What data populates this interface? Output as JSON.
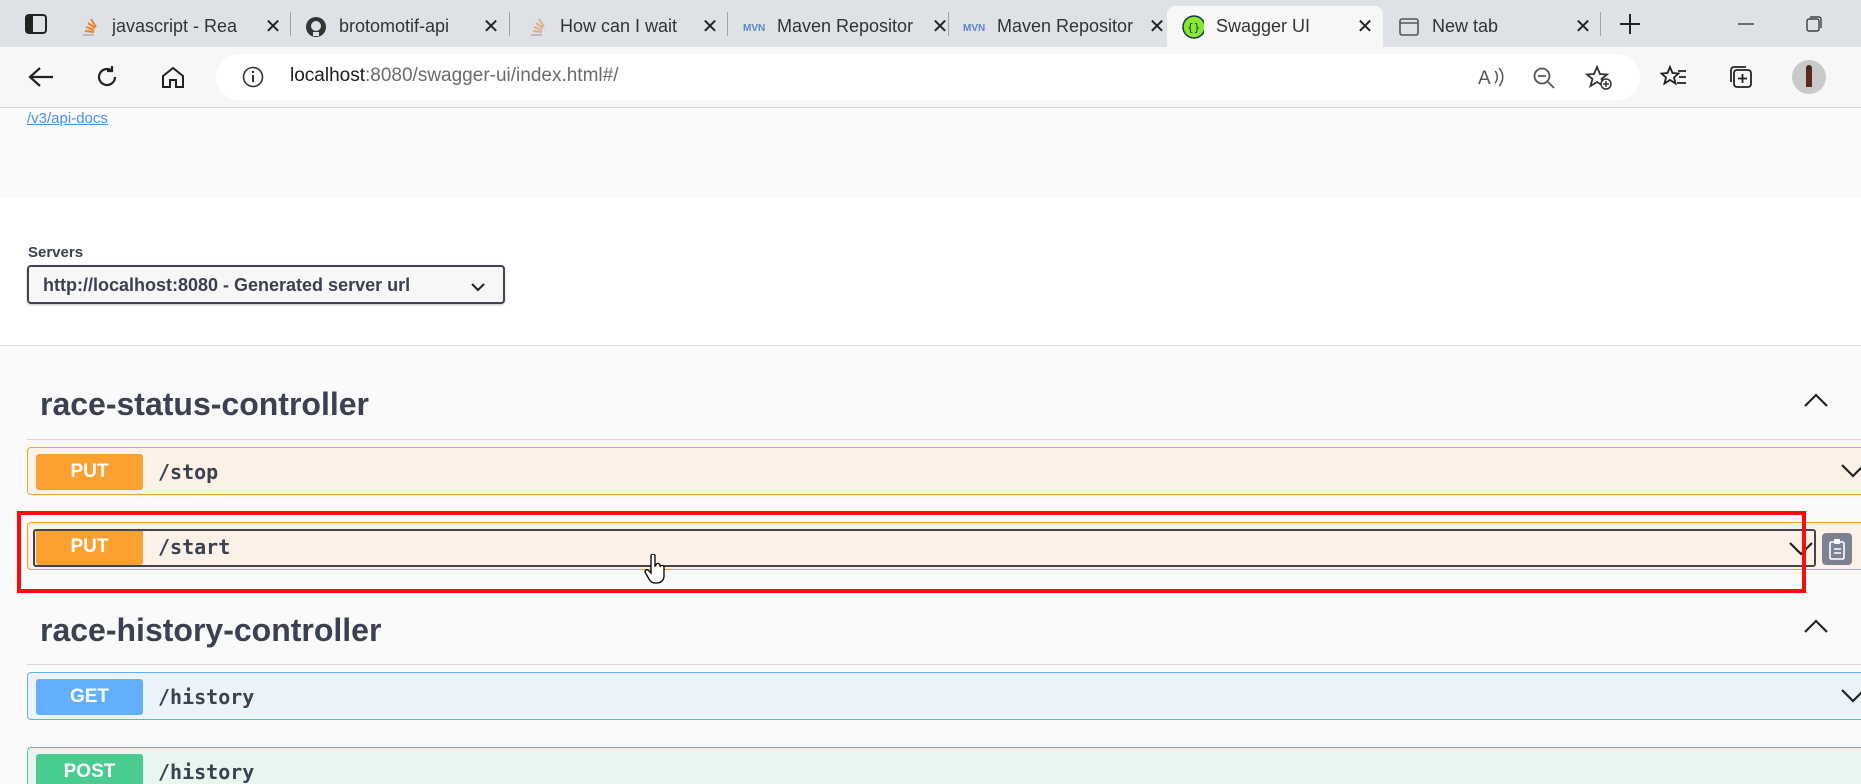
{
  "browser": {
    "tabs": [
      {
        "title": "javascript - Rea",
        "icon": "stackoverflow-icon"
      },
      {
        "title": "brotomotif-api",
        "icon": "github-icon"
      },
      {
        "title": "How can I wait",
        "icon": "stackoverflow-icon"
      },
      {
        "title": "Maven Repositor",
        "icon": "maven-icon"
      },
      {
        "title": "Maven Repositor",
        "icon": "maven-icon"
      },
      {
        "title": "Swagger UI",
        "icon": "swagger-icon"
      },
      {
        "title": "New tab",
        "icon": "newtab-icon"
      }
    ],
    "active_tab_index": 5,
    "maven_icon_text": "MVN",
    "url_host": "localhost",
    "url_rest": ":8080/swagger-ui/index.html#/"
  },
  "page": {
    "api_docs_link": "/v3/api-docs",
    "servers_label": "Servers",
    "server_selected": "http://localhost:8080 - Generated server url"
  },
  "controllers": [
    {
      "name": "race-status-controller",
      "operations": [
        {
          "method": "PUT",
          "path": "/stop"
        },
        {
          "method": "PUT",
          "path": "/start"
        }
      ]
    },
    {
      "name": "race-history-controller",
      "operations": [
        {
          "method": "GET",
          "path": "/history"
        },
        {
          "method": "POST",
          "path": "/history"
        }
      ]
    }
  ],
  "colors": {
    "put": "#fca130",
    "get": "#61affe",
    "post": "#49cc90",
    "highlight": "#ff0a0a"
  }
}
